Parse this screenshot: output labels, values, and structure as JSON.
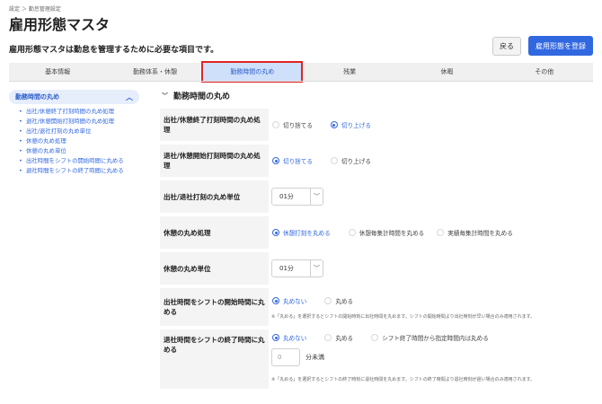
{
  "breadcrumb": "設定 ＞ 勤怠管理設定",
  "title": "雇用形態マスタ",
  "subtitle": "雇用形態マスタは勤怠を管理するために必要な項目です。",
  "buttons": {
    "back": "戻る",
    "register": "雇用形態を登録"
  },
  "tabs": [
    {
      "label": "基本情報",
      "active": false
    },
    {
      "label": "勤務体系・休憩",
      "active": false
    },
    {
      "label": "勤務時間の丸め",
      "active": true
    },
    {
      "label": "残業",
      "active": false
    },
    {
      "label": "休暇",
      "active": false
    },
    {
      "label": "その他",
      "active": false
    }
  ],
  "sidebar": {
    "header": "勤務時間の丸め",
    "items": [
      "出社/休憩終了打刻時間の丸め処理",
      "退社/休憩開始打刻時間の丸め処理",
      "出社/退社打刻の丸め単位",
      "休憩の丸め処理",
      "休憩の丸め単位",
      "出社時間をシフトの開始時間に丸める",
      "退社時間をシフトの終了時間に丸める"
    ]
  },
  "section_title": "勤務時間の丸め",
  "form": {
    "row1": {
      "label": "出社/休憩終了打刻時間の丸め処理",
      "options": [
        "切り捨てる",
        "切り上げる"
      ],
      "selected": 1
    },
    "row2": {
      "label": "退社/休憩開始打刻時間の丸め処理",
      "options": [
        "切り捨てる",
        "切り上げる"
      ],
      "selected": 0
    },
    "row3": {
      "label": "出社/退社打刻の丸め単位",
      "value": "01分"
    },
    "row4": {
      "label": "休憩の丸め処理",
      "options": [
        "休憩打刻を丸める",
        "休憩毎集計時間を丸める",
        "実績毎集計時間を丸める"
      ],
      "selected": 0
    },
    "row5": {
      "label": "休憩の丸め単位",
      "value": "01分"
    },
    "row6": {
      "label": "出社時間をシフトの開始時間に丸める",
      "options": [
        "丸めない",
        "丸める"
      ],
      "selected": 0,
      "note": "※「丸める」を選択するとシフトの開始時刻に出社時間を丸めます。シフトの開始時間より出社時刻が早い場合のみ適用されます。"
    },
    "row7": {
      "label": "退社時間をシフトの終了時間に丸める",
      "options": [
        "丸めない",
        "丸める",
        "シフト終了時間から指定時間内は丸める"
      ],
      "selected": 0,
      "input_value": "0",
      "unit": "分未満",
      "note": "※「丸める」を選択するとシフトの終了時刻に退社時間を丸めます。シフトの終了時間より退社時刻が遅い場合のみ適用されます。"
    }
  },
  "colors": {
    "accent": "#3168e0",
    "highlight": "#e02424",
    "active_tab_bg": "#cfe0fb"
  }
}
